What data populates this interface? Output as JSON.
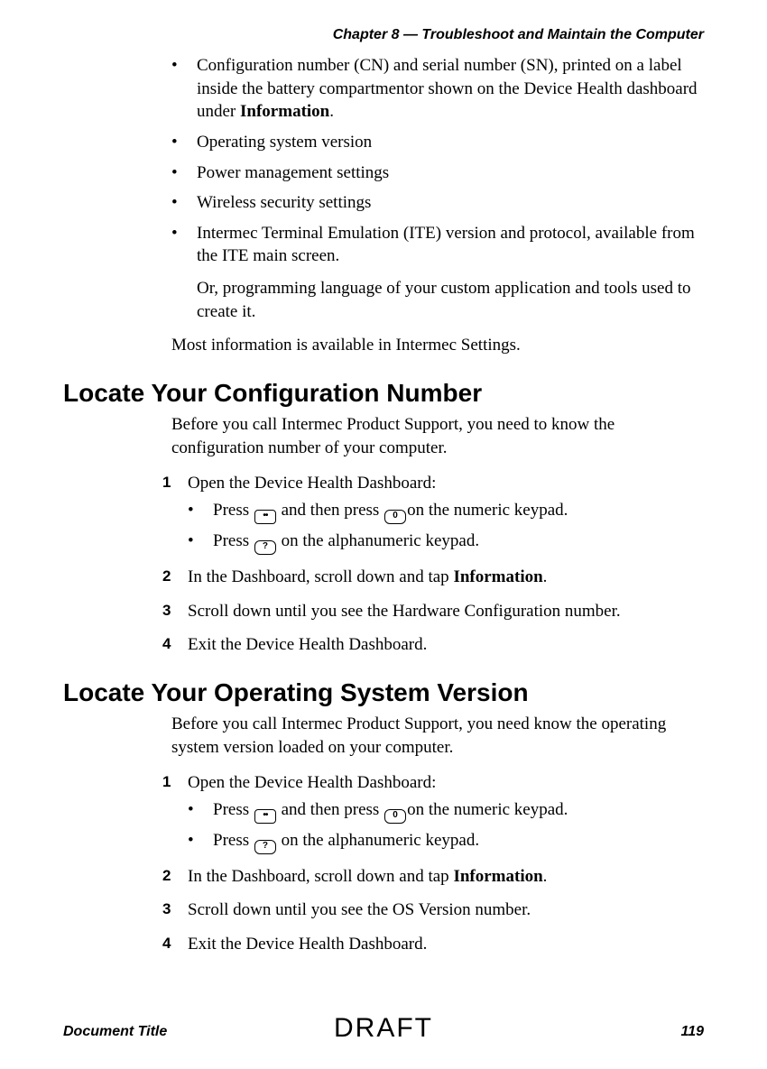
{
  "header": {
    "chapter": "Chapter 8 — Troubleshoot and Maintain the Computer"
  },
  "top_bullets": [
    {
      "text_pre": "Configuration number (CN) and serial number (SN), printed on a label inside the battery compartmentor shown on the Device Health dashboard under ",
      "bold": "Information",
      "text_post": "."
    },
    {
      "text_pre": "Operating system version"
    },
    {
      "text_pre": "Power management settings"
    },
    {
      "text_pre": "Wireless security settings"
    },
    {
      "text_pre": "Intermec Terminal Emulation (ITE) version and protocol, available from the ITE main screen.",
      "continuation": "Or, programming language of your custom application and tools used to create it."
    }
  ],
  "after_bullets_para": "Most information is available in Intermec Settings.",
  "section1": {
    "title": "Locate Your Configuration Number",
    "intro": "Before you call Intermec Product Support, you need to know the configuration number of your computer.",
    "steps": {
      "s1": "Open the Device Health Dashboard:",
      "s1_sub_a_pre": "Press ",
      "s1_sub_a_mid": " and then press ",
      "s1_sub_a_post": "on the numeric keypad.",
      "s1_sub_b_pre": "Press ",
      "s1_sub_b_post": " on the alphanumeric keypad.",
      "s2_pre": "In the Dashboard, scroll down and tap ",
      "s2_bold": "Information",
      "s2_post": ".",
      "s3": "Scroll down until you see the Hardware Configuration number.",
      "s4": "Exit the Device Health Dashboard."
    }
  },
  "section2": {
    "title": "Locate Your Operating System Version",
    "intro": "Before you call Intermec Product Support, you need know the operating system version loaded on your computer.",
    "steps": {
      "s1": "Open the Device Health Dashboard:",
      "s1_sub_a_pre": "Press ",
      "s1_sub_a_mid": " and then press ",
      "s1_sub_a_post": "on the numeric keypad.",
      "s1_sub_b_pre": "Press ",
      "s1_sub_b_post": " on the alphanumeric keypad.",
      "s2_pre": "In the Dashboard, scroll down and tap ",
      "s2_bold": "Information",
      "s2_post": ".",
      "s3": "Scroll down until you see the OS Version number.",
      "s4": "Exit the Device Health Dashboard."
    }
  },
  "footer": {
    "doc_title": "Document Title",
    "page_number": "119",
    "watermark": "DRAFT"
  },
  "labels": {
    "n1": "1",
    "n2": "2",
    "n3": "3",
    "n4": "4"
  }
}
